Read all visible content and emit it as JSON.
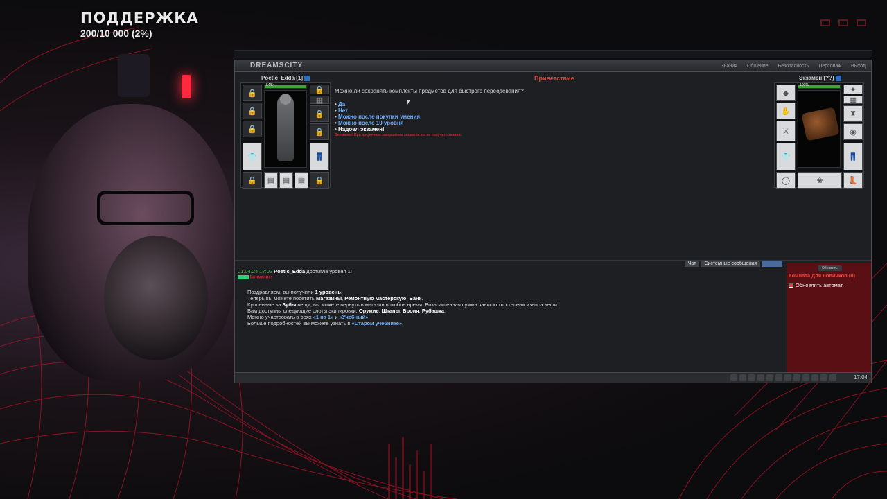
{
  "overlay": {
    "support_title": "ПОДДЕРЖКА",
    "support_count": "200/10 000 (2%)",
    "support_progress_percent": 2
  },
  "game": {
    "logo": "DREAMSCITY",
    "menu": [
      "Знания",
      "Общение",
      "Безопасность",
      "Персонаж",
      "Выход"
    ],
    "left_player": {
      "name": "Poetic_Edda",
      "level": "[1]",
      "hp": "54/54"
    },
    "right_player": {
      "name": "Экзамен",
      "level": "[??]",
      "hp": "100%"
    },
    "dialog_title": "Приветствие",
    "question": "Можно ли сохранять комплекты предметов для быстрого переодевания?",
    "options": [
      "Да",
      "Нет",
      "Можно после покупки умения",
      "Можно после 10 уровня",
      "Надоел экзамен!"
    ],
    "warning": "Внимание! При досрочном завершении экзамена вы не получите знания."
  },
  "chat": {
    "tabs": [
      "Чат",
      "Системные сообщения"
    ],
    "time": "01.04.24 17:02",
    "user": "Poetic_Edda",
    "event": "достигла уровня 1!",
    "attention": "Внимание:",
    "l1_pre": "Поздравляем, вы получили",
    "l1_b": "1 уровень",
    "l2_pre": "Теперь вы можете посетить",
    "l2_shops": "Магазины",
    "l2_repair": "Ремонтную мастерскую",
    "l2_bank": "Банк",
    "l3_pre": "Купленные за",
    "l3_teeth": "Зубы",
    "l3_post": "вещи, вы можете вернуть в магазин в любое время. Возвращенная сумма зависит от степени износа вещи.",
    "l4_pre": "Вам доступны следующие слоты экипировки:",
    "l4_slots": [
      "Оружие",
      "Штаны",
      "Броня",
      "Рубашка"
    ],
    "l5_pre": "Можно участвовать в боях",
    "l5_a": "«1 на 1»",
    "l5_and": "и",
    "l5_b": "«Учебный»",
    "l6_pre": "Больше подробностей вы можете узнать в",
    "l6_link": "«Старом учебнике»"
  },
  "room": {
    "refresh": "Обновить",
    "title": "Комната для новичков (0)",
    "auto_label": "Обновлять автомат."
  },
  "status": {
    "clock": "17:04"
  },
  "colors": {
    "accent_red": "#e8453a",
    "link_blue": "#6fb0ff",
    "hp_green": "#3fa33a"
  }
}
